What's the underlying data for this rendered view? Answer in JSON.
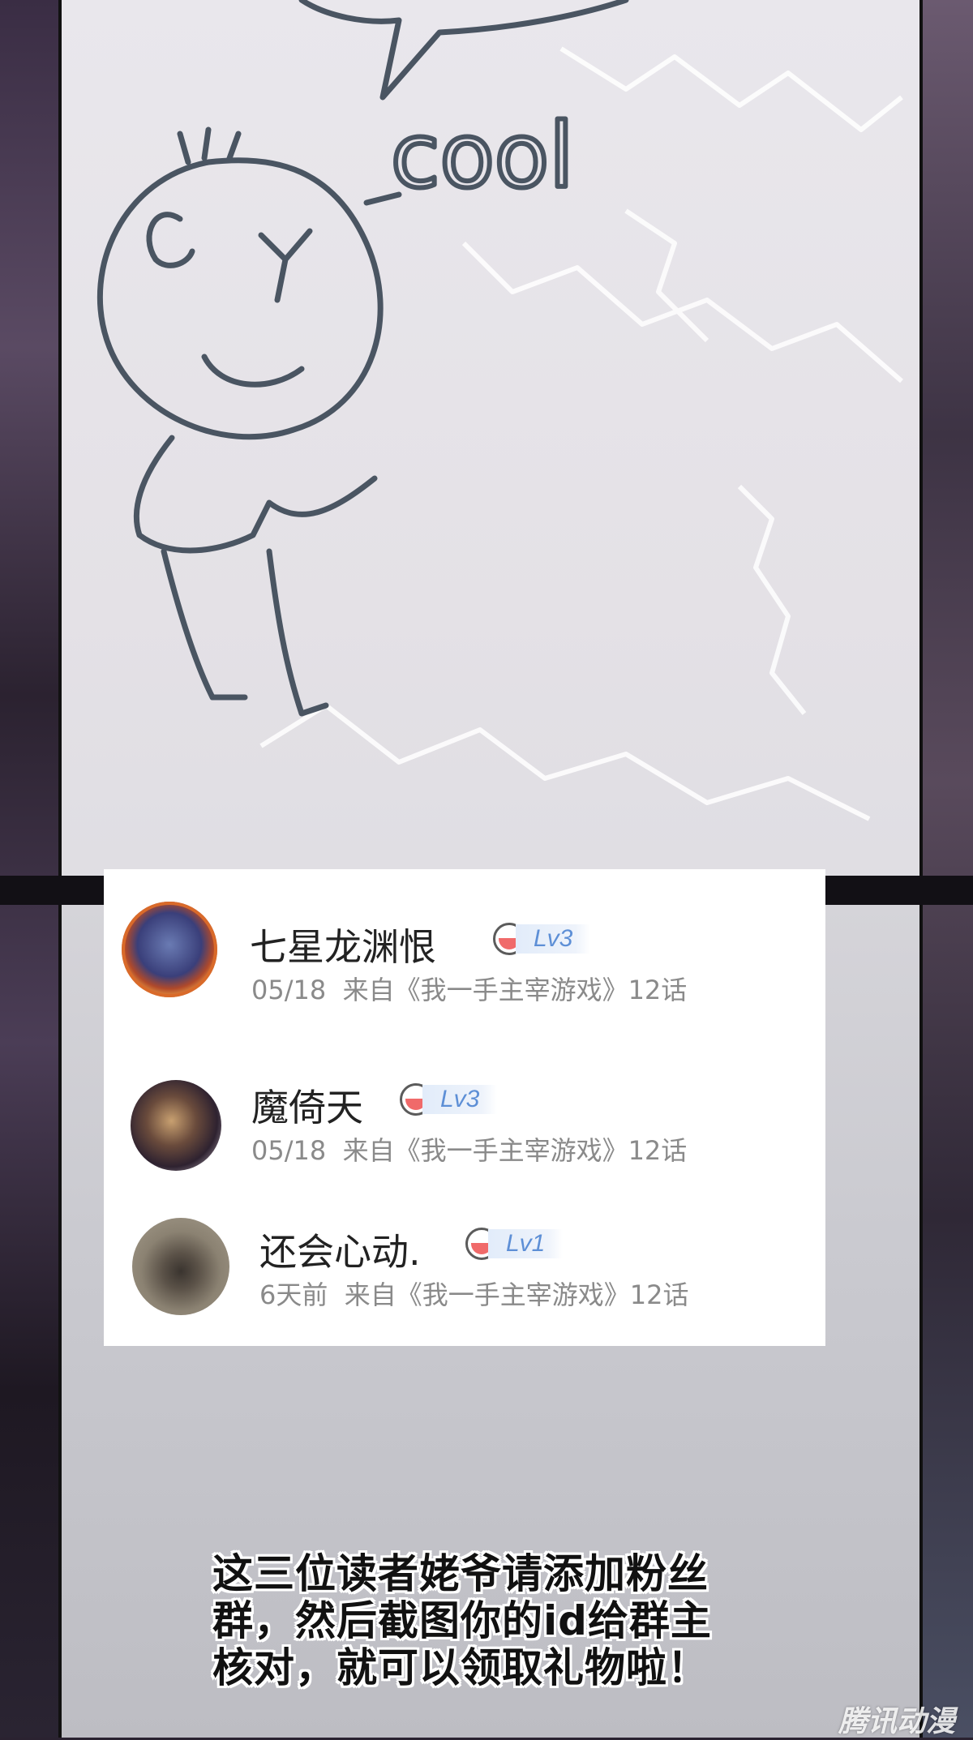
{
  "sketch": {
    "word": "cool"
  },
  "comments": [
    {
      "name": "七星龙渊恨",
      "level": "Lv3",
      "date": "05/18",
      "source": "来自《我一手主宰游戏》12话"
    },
    {
      "name": "魔倚天",
      "level": "Lv3",
      "date": "05/18",
      "source": "来自《我一手主宰游戏》12话"
    },
    {
      "name": "还会心动.",
      "level": "Lv1",
      "date": "6天前",
      "source": "来自《我一手主宰游戏》12话"
    }
  ],
  "caption": "这三位读者姥爷请添加粉丝群，然后截图你的id给群主核对，就可以领取礼物啦！",
  "watermark": "腾讯动漫",
  "colors": {
    "level_text": "#5d8fd6",
    "meta_text": "#8a8a8a",
    "name_text": "#222222"
  }
}
